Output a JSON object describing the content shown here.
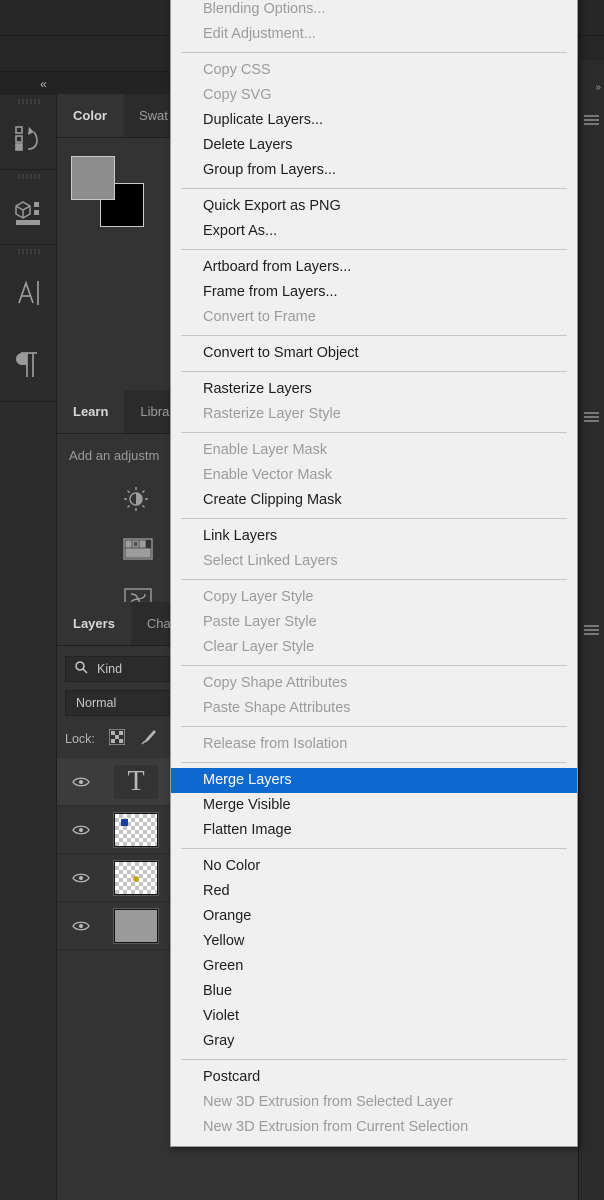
{
  "app": {
    "collapse_icon": "«",
    "right_strip": {
      "expand_icon": "»"
    }
  },
  "panels": {
    "color": {
      "tabs": [
        {
          "label": "Color",
          "active": true
        },
        {
          "label": "Swat",
          "active": false
        }
      ],
      "foreground_color": "#8d8d8d",
      "background_color": "#000000"
    },
    "adjustments": {
      "tabs": [
        {
          "label": "Learn",
          "active": true
        },
        {
          "label": "Libra",
          "active": false
        }
      ],
      "hint": "Add an adjustm",
      "icons": [
        "brightness-contrast-icon",
        "levels-icon",
        "curves-icon",
        "exposure-icon",
        "vibrance-icon",
        "hue-saturation-icon"
      ]
    },
    "layers": {
      "tabs": [
        {
          "label": "Layers",
          "active": true
        },
        {
          "label": "Cha",
          "active": false
        }
      ],
      "filter": {
        "icon": "search-icon",
        "value": "Kind"
      },
      "blend_mode": "Normal",
      "lock": {
        "label": "Lock:",
        "icons": [
          "transparency-lock-icon",
          "brush-lock-icon"
        ]
      },
      "rows": [
        {
          "visible": true,
          "kind": "text",
          "glyph": "T",
          "selected": true
        },
        {
          "visible": true,
          "kind": "transparent-blue",
          "glyph": "",
          "selected": false
        },
        {
          "visible": true,
          "kind": "transparent-yellow",
          "glyph": "",
          "selected": false
        },
        {
          "visible": true,
          "kind": "solid-gray",
          "glyph": "",
          "selected": false
        }
      ]
    }
  },
  "context_menu": {
    "highlight_color": "#0e69cf",
    "groups": [
      {
        "items": [
          {
            "label": "Blending Options...",
            "disabled": true
          },
          {
            "label": "Edit Adjustment...",
            "disabled": true
          }
        ]
      },
      {
        "items": [
          {
            "label": "Copy CSS",
            "disabled": true
          },
          {
            "label": "Copy SVG",
            "disabled": true
          },
          {
            "label": "Duplicate Layers...",
            "disabled": false
          },
          {
            "label": "Delete Layers",
            "disabled": false
          },
          {
            "label": "Group from Layers...",
            "disabled": false
          }
        ]
      },
      {
        "items": [
          {
            "label": "Quick Export as PNG",
            "disabled": false
          },
          {
            "label": "Export As...",
            "disabled": false
          }
        ]
      },
      {
        "items": [
          {
            "label": "Artboard from Layers...",
            "disabled": false
          },
          {
            "label": "Frame from Layers...",
            "disabled": false
          },
          {
            "label": "Convert to Frame",
            "disabled": true
          }
        ]
      },
      {
        "items": [
          {
            "label": "Convert to Smart Object",
            "disabled": false
          }
        ]
      },
      {
        "items": [
          {
            "label": "Rasterize Layers",
            "disabled": false
          },
          {
            "label": "Rasterize Layer Style",
            "disabled": true
          }
        ]
      },
      {
        "items": [
          {
            "label": "Enable Layer Mask",
            "disabled": true
          },
          {
            "label": "Enable Vector Mask",
            "disabled": true
          },
          {
            "label": "Create Clipping Mask",
            "disabled": false
          }
        ]
      },
      {
        "items": [
          {
            "label": "Link Layers",
            "disabled": false
          },
          {
            "label": "Select Linked Layers",
            "disabled": true
          }
        ]
      },
      {
        "items": [
          {
            "label": "Copy Layer Style",
            "disabled": true
          },
          {
            "label": "Paste Layer Style",
            "disabled": true
          },
          {
            "label": "Clear Layer Style",
            "disabled": true
          }
        ]
      },
      {
        "items": [
          {
            "label": "Copy Shape Attributes",
            "disabled": true
          },
          {
            "label": "Paste Shape Attributes",
            "disabled": true
          }
        ]
      },
      {
        "items": [
          {
            "label": "Release from Isolation",
            "disabled": true
          }
        ]
      },
      {
        "items": [
          {
            "label": "Merge Layers",
            "disabled": false,
            "highlighted": true
          },
          {
            "label": "Merge Visible",
            "disabled": false
          },
          {
            "label": "Flatten Image",
            "disabled": false
          }
        ]
      },
      {
        "items": [
          {
            "label": "No Color",
            "disabled": false
          },
          {
            "label": "Red",
            "disabled": false
          },
          {
            "label": "Orange",
            "disabled": false
          },
          {
            "label": "Yellow",
            "disabled": false
          },
          {
            "label": "Green",
            "disabled": false
          },
          {
            "label": "Blue",
            "disabled": false
          },
          {
            "label": "Violet",
            "disabled": false
          },
          {
            "label": "Gray",
            "disabled": false
          }
        ]
      },
      {
        "items": [
          {
            "label": "Postcard",
            "disabled": false
          },
          {
            "label": "New 3D Extrusion from Selected Layer",
            "disabled": true
          },
          {
            "label": "New 3D Extrusion from Current Selection",
            "disabled": true
          }
        ]
      }
    ]
  }
}
